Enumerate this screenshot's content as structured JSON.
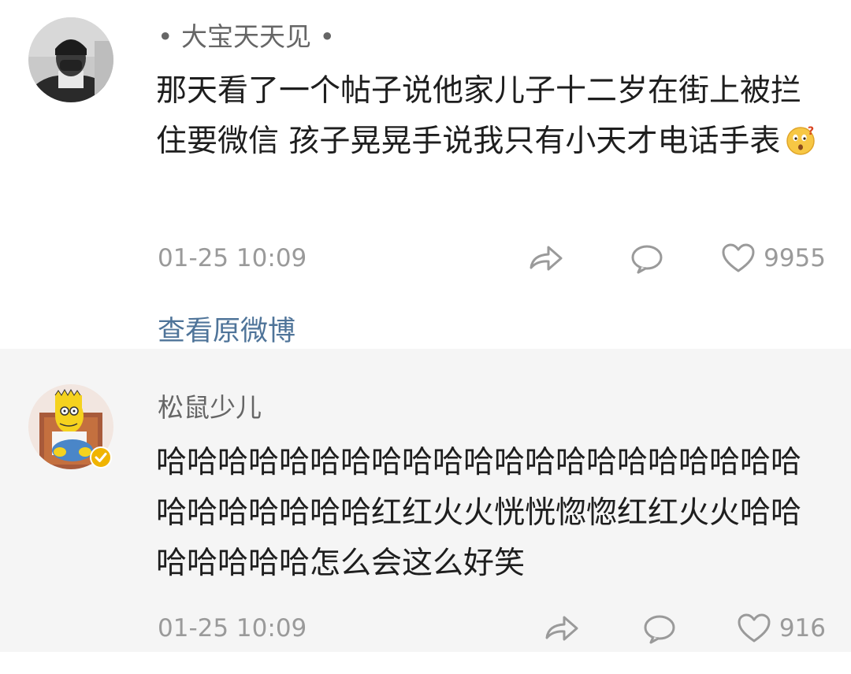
{
  "comments": [
    {
      "username": "• 大宝天天见 •",
      "text": "那天看了一个帖子说他家儿子十二岁在街上被拦住要微信 孩子晃晃手说我只有小天才电话手表",
      "emoji": "thinking-face-emoji",
      "timestamp": "01-25 10:09",
      "likes": "9955",
      "view_original": "查看原微博"
    },
    {
      "username": "松鼠少儿",
      "text": "哈哈哈哈哈哈哈哈哈哈哈哈哈哈哈哈哈哈哈哈哈哈哈哈哈哈哈哈红红火火恍恍惚惚红红火火哈哈哈哈哈哈哈怎么会这么好笑",
      "timestamp": "01-25 10:09",
      "likes": "916",
      "verified": true
    }
  ],
  "colors": {
    "link": "#4f7499",
    "meta_text": "#9a9a9a",
    "username": "#666666",
    "alt_background": "#f5f5f5",
    "verified_badge": "#f0b400"
  },
  "icons": [
    "share-arrow-icon",
    "comment-bubble-icon",
    "heart-icon",
    "verified-badge-icon"
  ]
}
